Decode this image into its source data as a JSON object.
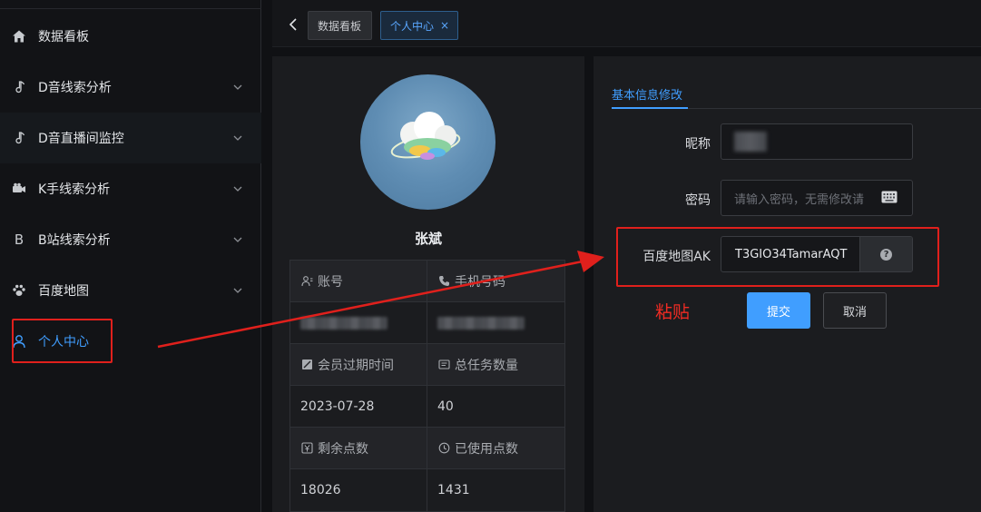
{
  "sidebar": {
    "items": [
      {
        "label": "数据看板",
        "icon": "home-icon"
      },
      {
        "label": "D音线索分析",
        "icon": "music-note-icon"
      },
      {
        "label": "D音直播间监控",
        "icon": "music-note-icon"
      },
      {
        "label": "K手线索分析",
        "icon": "video-camera-icon"
      },
      {
        "label": "B站线索分析",
        "icon": "b-letter-icon",
        "glyph": "B"
      },
      {
        "label": "百度地图",
        "icon": "paw-icon"
      },
      {
        "label": "个人中心",
        "icon": "user-icon"
      }
    ]
  },
  "tabs": {
    "home_label": "数据看板",
    "active_label": "个人中心",
    "close_glyph": "×"
  },
  "profile": {
    "name": "张斌",
    "fields": {
      "account_label": "账号",
      "phone_label": "手机号码",
      "expire_label": "会员过期时间",
      "total_tasks_label": "总任务数量",
      "expire_value": "2023-07-28",
      "total_tasks_value": "40",
      "remaining_label": "剩余点数",
      "used_label": "已使用点数",
      "remaining_value": "18026",
      "used_value": "1431"
    }
  },
  "form": {
    "tab_label": "基本信息修改",
    "nickname_label": "昵称",
    "password_label": "密码",
    "password_placeholder": "请输入密码，无需修改请",
    "ak_label": "百度地图AK",
    "ak_value": "T3GIO34TamarAQT",
    "help_glyph": "?",
    "submit_label": "提交",
    "cancel_label": "取消"
  },
  "annotation": {
    "paste_note": "粘贴",
    "highlight_color": "#e0201c"
  },
  "colors": {
    "accent": "#409eff",
    "background": "#101114",
    "card": "#1b1c1f"
  }
}
